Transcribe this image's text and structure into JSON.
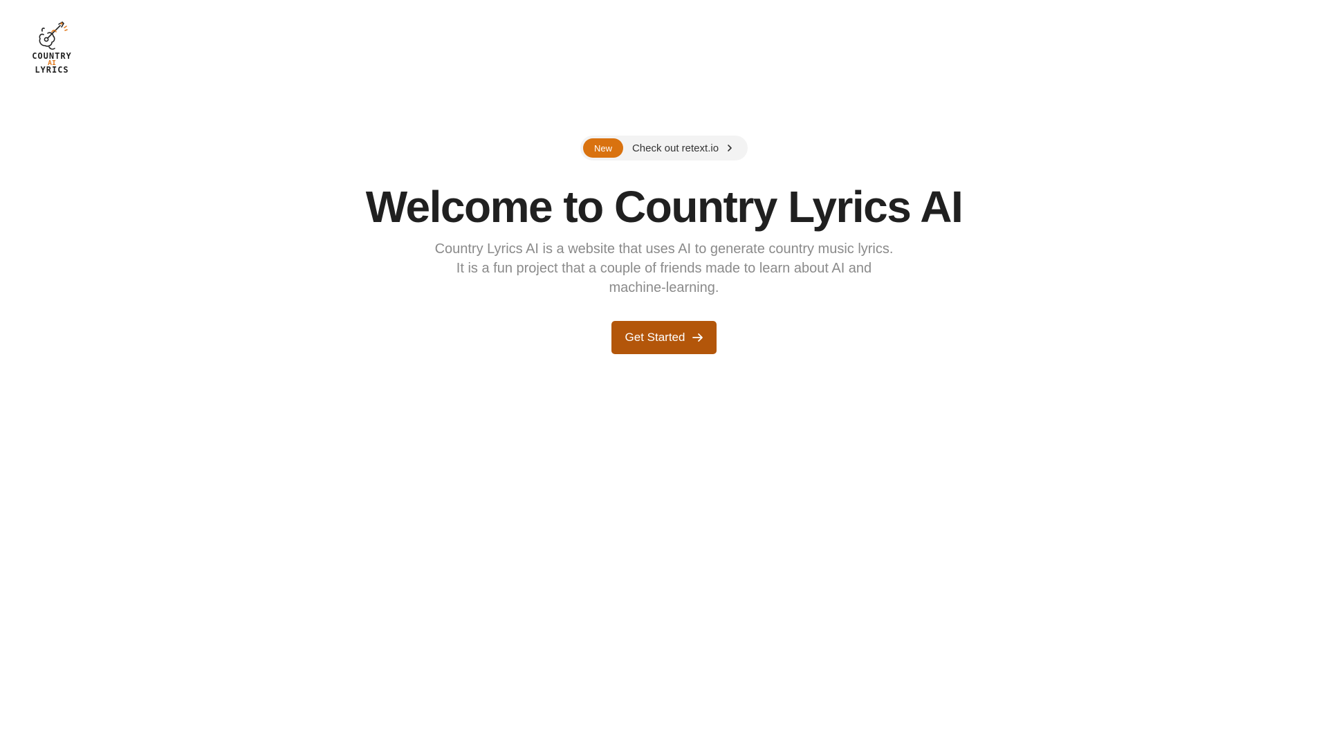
{
  "logo": {
    "line1": "COUNTRY",
    "line2": "AI",
    "line3": "LYRICS",
    "icon": "guitar-icon"
  },
  "announcement": {
    "badge": "New",
    "text": "Check out retext.io",
    "icon": "chevron-right-icon"
  },
  "hero": {
    "title": "Welcome to Country Lyrics AI",
    "subtitle": "Country Lyrics AI is a website that uses AI to generate country music lyrics. It is a fun project that a couple of friends made to learn about AI and machine-learning."
  },
  "cta": {
    "label": "Get Started",
    "icon": "arrow-right-icon"
  },
  "colors": {
    "badge": "#d9720f",
    "button": "#b3560a",
    "title": "#202020",
    "subtitle": "#8a8a8a"
  }
}
